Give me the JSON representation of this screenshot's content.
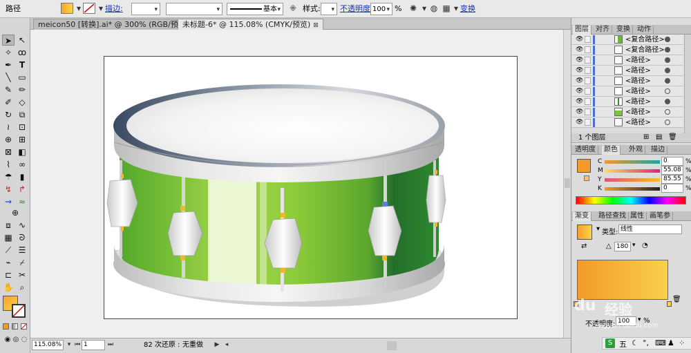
{
  "control_bar": {
    "object_type": "路径",
    "fill_color": "#f6a623",
    "stroke_label": "描边:",
    "stroke_profile": "基本",
    "style_label": "样式:",
    "opacity_label": "不透明度:",
    "opacity_value": "100",
    "percent": "%",
    "transform_label": "变换"
  },
  "tabs": [
    {
      "label": "meicon50 [转换].ai* @ 300% (RGB/预览)"
    },
    {
      "label": "未标题-6* @ 115.08% (CMYK/预览)"
    }
  ],
  "status": {
    "zoom": "115.08%",
    "page": "1",
    "undo": "82 次还原",
    "redo": "无重做",
    "separator": ":"
  },
  "layers_panel": {
    "tabs": [
      "图层",
      "对齐",
      "变换",
      "动作"
    ],
    "rows": [
      {
        "name": "<复合路径>",
        "target": "filled"
      },
      {
        "name": "<复合路径>",
        "target": "filled"
      },
      {
        "name": "<路径>",
        "target": "filled"
      },
      {
        "name": "<路径>",
        "target": "filled"
      },
      {
        "name": "<路径>",
        "target": "filled"
      },
      {
        "name": "<路径>",
        "target": "open"
      },
      {
        "name": "<路径>",
        "target": "filled"
      },
      {
        "name": "<路径>",
        "target": "open"
      },
      {
        "name": "<路径>",
        "target": "open"
      }
    ],
    "layer_count": "1 个图层"
  },
  "color_panel": {
    "tabs": [
      "透明度",
      "颜色",
      "外观",
      "描边"
    ],
    "active_swatch": "#f39a2a",
    "channels": [
      {
        "label": "C",
        "value": "0",
        "pct": "%"
      },
      {
        "label": "M",
        "value": "55.08",
        "pct": "%"
      },
      {
        "label": "Y",
        "value": "85.55",
        "pct": "%"
      },
      {
        "label": "K",
        "value": "0",
        "pct": "%"
      }
    ]
  },
  "gradient_panel": {
    "tabs": [
      "渐变",
      "路径查找",
      "属性",
      "画笔参"
    ],
    "type_label": "类型:",
    "type_value": "线性",
    "angle": "180",
    "opacity_label": "不透明度:",
    "opacity_value": "100",
    "opacity_pct": "%",
    "color_start": "#f7a32b",
    "color_end": "#f9d04a"
  },
  "watermark": {
    "text": "经验",
    "url": "jingyan.baidu.com"
  },
  "ime": {
    "label": "五"
  }
}
